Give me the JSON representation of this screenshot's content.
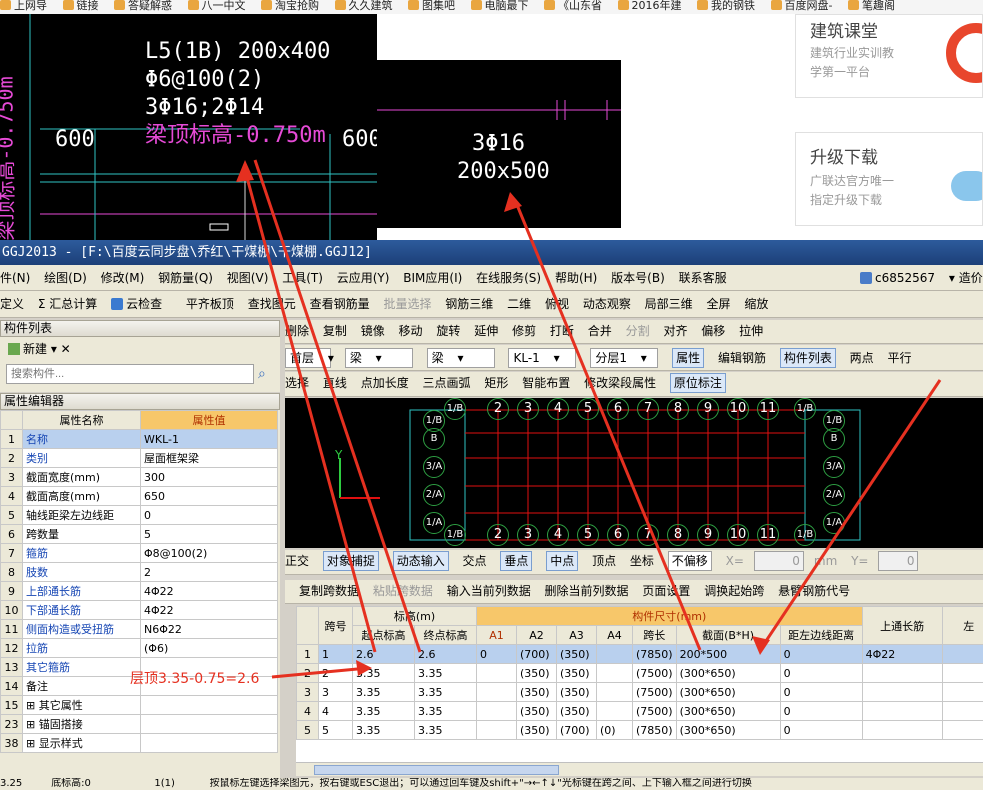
{
  "bookmarks": [
    "上网导",
    "链接",
    "答疑解惑",
    "八一中文",
    "淘宝抢购",
    "久久建筑",
    "图集吧",
    "电脑最下",
    "《山东省",
    "2016年建",
    "我的钢铁",
    "百度网盘-",
    "笔趣阁"
  ],
  "cad_top": {
    "beam_label": [
      "L5(1B) 200x400",
      "Φ6@100(2)",
      "3Φ16;2Φ14",
      "梁顶标高-0.750m"
    ],
    "dim_left": "600",
    "dim_right": "600",
    "vertical_text": "梁顶标高-0.750m"
  },
  "cad_zoom": {
    "line1": "3Φ16",
    "line2": "200x500"
  },
  "ads": [
    {
      "title": "建筑课堂",
      "lines": [
        "建筑行业实训教",
        "学第一平台"
      ]
    },
    {
      "title": "升级下载",
      "lines": [
        "广联达官方唯一",
        "指定升级下载"
      ]
    }
  ],
  "window_title": "GGJ2013 - [F:\\百度云同步盘\\乔红\\干煤棚\\干煤棚.GGJ12]",
  "menu": [
    "件(N)",
    "绘图(D)",
    "修改(M)",
    "钢筋量(Q)",
    "视图(V)",
    "工具(T)",
    "云应用(Y)",
    "BIM应用(I)",
    "在线服务(S)",
    "帮助(H)",
    "版本号(B)",
    "联系客服"
  ],
  "menu_right": {
    "user": "c6852567",
    "extra": "造价豆"
  },
  "toolbar1": [
    "定义",
    "Σ 汇总计算",
    "云检查",
    "平齐板顶",
    "查找图元",
    "查看钢筋量",
    "批量选择",
    "钢筋三维",
    "二维",
    "俯视",
    "动态观察",
    "局部三维",
    "全屏",
    "缩放"
  ],
  "toolbar2": [
    "删除",
    "复制",
    "镜像",
    "移动",
    "旋转",
    "延伸",
    "修剪",
    "打断",
    "合并",
    "分割",
    "对齐",
    "偏移",
    "拉伸"
  ],
  "toolbar3": {
    "floor": "首层",
    "type1": "梁",
    "type2": "梁",
    "item": "KL-1",
    "layer": "分层1",
    "buttons": [
      "属性",
      "编辑钢筋",
      "构件列表",
      "两点",
      "平行"
    ]
  },
  "toolbar4": [
    "选择",
    "直线",
    "点加长度",
    "三点画弧",
    "矩形",
    "智能布置",
    "修改梁段属性",
    "原位标注"
  ],
  "component_list": {
    "title": "构件列表",
    "new_label": "新建",
    "search_placeholder": "搜索构件..."
  },
  "prop_editor": {
    "title": "属性编辑器",
    "col_name": "属性名称",
    "col_value": "属性值",
    "rows": [
      {
        "n": "1",
        "name": "名称",
        "value": "WKL-1",
        "blue": true
      },
      {
        "n": "2",
        "name": "类别",
        "value": "屋面框架梁",
        "blue": true
      },
      {
        "n": "3",
        "name": "截面宽度(mm)",
        "value": "300",
        "blue": false
      },
      {
        "n": "4",
        "name": "截面高度(mm)",
        "value": "650",
        "blue": false
      },
      {
        "n": "5",
        "name": "轴线距梁左边线距",
        "value": "0",
        "blue": false
      },
      {
        "n": "6",
        "name": "跨数量",
        "value": "5",
        "blue": false
      },
      {
        "n": "7",
        "name": "箍筋",
        "value": "Φ8@100(2)",
        "blue": true
      },
      {
        "n": "8",
        "name": "肢数",
        "value": "2",
        "blue": true
      },
      {
        "n": "9",
        "name": "上部通长筋",
        "value": "4Φ22",
        "blue": true
      },
      {
        "n": "10",
        "name": "下部通长筋",
        "value": "4Φ22",
        "blue": true
      },
      {
        "n": "11",
        "name": "侧面构造或受扭筋",
        "value": "N6Φ22",
        "blue": true
      },
      {
        "n": "12",
        "name": "拉筋",
        "value": "(Φ6)",
        "blue": true
      },
      {
        "n": "13",
        "name": "其它箍筋",
        "value": "",
        "blue": true
      },
      {
        "n": "14",
        "name": "备注",
        "value": "",
        "blue": false
      },
      {
        "n": "15",
        "name": "其它属性",
        "value": "",
        "blue": false
      },
      {
        "n": "23",
        "name": "锚固搭接",
        "value": "",
        "blue": false
      },
      {
        "n": "38",
        "name": "显示样式",
        "value": "",
        "blue": false
      }
    ]
  },
  "model_axes_top": [
    "1/B",
    "2",
    "3",
    "4",
    "5",
    "6",
    "7",
    "8",
    "9",
    "10",
    "11",
    "1/B"
  ],
  "model_axes_bottom": [
    "1/B",
    "2",
    "3",
    "4",
    "5",
    "6",
    "7",
    "8",
    "9",
    "10",
    "11",
    "1/B"
  ],
  "model_axes_left": [
    "1/B",
    "B",
    "3/A",
    "2/A",
    "1/A"
  ],
  "model_axes_right": [
    "1/B",
    "B",
    "3/A",
    "2/A",
    "1/A"
  ],
  "snapbar": [
    "正交",
    "对象捕捉",
    "动态输入",
    "交点",
    "垂点",
    "中点",
    "顶点",
    "坐标",
    "不偏移",
    "X=",
    "0",
    "mm",
    "Y=",
    "0"
  ],
  "tablebar": [
    "复制跨数据",
    "粘贴跨数据",
    "输入当前列数据",
    "删除当前列数据",
    "页面设置",
    "调换起始跨",
    "悬臂钢筋代号"
  ],
  "span_table": {
    "header_group_elev": "标高(m)",
    "header_group_size": "构件尺寸(mm)",
    "col_span": "跨号",
    "col_start": "起点标高",
    "col_end": "终点标高",
    "cols_size": [
      "A1",
      "A2",
      "A3",
      "A4",
      "跨长",
      "截面(B*H)",
      "距左边线距离"
    ],
    "col_top": "上通长筋",
    "col_left": "左",
    "rows": [
      {
        "n": "1",
        "span": "1",
        "start": "2.6",
        "end": "2.6",
        "a1": "0",
        "a2": "(700)",
        "a3": "(350)",
        "a4": "",
        "len": "(7850)",
        "sec": "200*500",
        "dist": "0",
        "top": "4Φ22"
      },
      {
        "n": "2",
        "span": "2",
        "start": "3.35",
        "end": "3.35",
        "a1": "",
        "a2": "(350)",
        "a3": "(350)",
        "a4": "",
        "len": "(7500)",
        "sec": "(300*650)",
        "dist": "0",
        "top": ""
      },
      {
        "n": "3",
        "span": "3",
        "start": "3.35",
        "end": "3.35",
        "a1": "",
        "a2": "(350)",
        "a3": "(350)",
        "a4": "",
        "len": "(7500)",
        "sec": "(300*650)",
        "dist": "0",
        "top": ""
      },
      {
        "n": "4",
        "span": "4",
        "start": "3.35",
        "end": "3.35",
        "a1": "",
        "a2": "(350)",
        "a3": "(350)",
        "a4": "",
        "len": "(7500)",
        "sec": "(300*650)",
        "dist": "0",
        "top": ""
      },
      {
        "n": "5",
        "span": "5",
        "start": "3.35",
        "end": "3.35",
        "a1": "",
        "a2": "(350)",
        "a3": "(700)",
        "a4": "(0)",
        "len": "(7850)",
        "sec": "(300*650)",
        "dist": "0",
        "top": ""
      }
    ]
  },
  "annotation": "层顶3.35-0.75=2.6",
  "status": [
    "3.25",
    "底标高:0",
    "1(1)",
    "按鼠标左键选择梁图元，按右键或ESC退出；可以通过回车键及shift+\"→←↑↓\"光标键在跨之间、上下输入框之间进行切换"
  ]
}
